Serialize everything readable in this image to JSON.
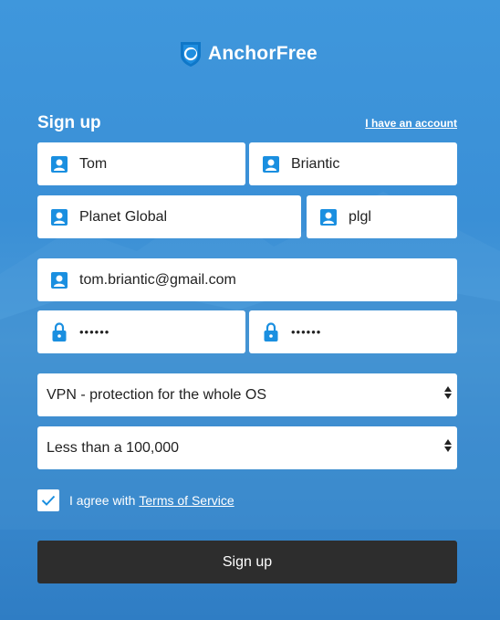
{
  "brand": {
    "name": "AnchorFree"
  },
  "header": {
    "title": "Sign up",
    "account_link": "I have an account"
  },
  "fields": {
    "first_name": "Tom",
    "last_name": "Briantic",
    "company": "Planet Global",
    "short_name": "plgl",
    "email": "tom.briantic@gmail.com",
    "password": "••••••",
    "password_confirm": "••••••"
  },
  "selects": {
    "usage": "VPN - protection for the whole OS",
    "size": "Less than a 100,000"
  },
  "agree": {
    "text": "I agree with",
    "link": "Terms of Service",
    "checked": true
  },
  "submit_label": "Sign up",
  "colors": {
    "accent": "#1a8fe0",
    "background": "#3f97dc",
    "button": "#2d2d2d"
  }
}
